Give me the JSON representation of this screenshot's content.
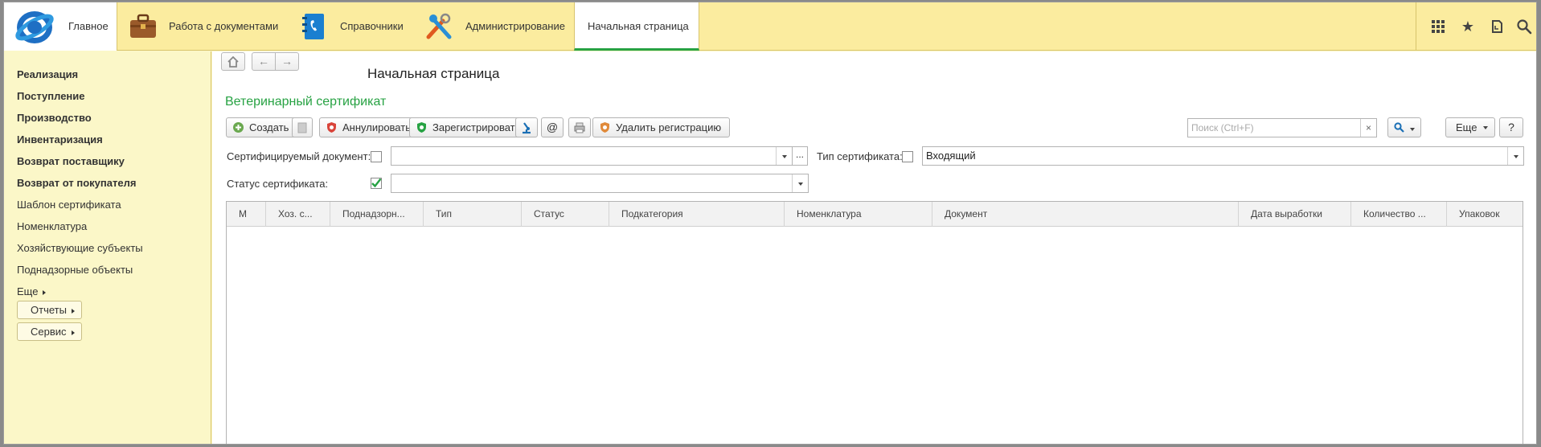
{
  "topbar": {
    "main_label": "Главное",
    "sections": [
      {
        "label": "Работа с документами",
        "icon": "briefcase-icon"
      },
      {
        "label": "Справочники",
        "icon": "phonebook-icon"
      },
      {
        "label": "Администрирование",
        "icon": "tools-icon"
      }
    ],
    "active_tab": "Начальная страница",
    "right_icons": [
      "apps-grid-icon",
      "star-icon",
      "history-icon",
      "search-icon"
    ]
  },
  "sidebar": {
    "items": [
      {
        "label": "Реализация",
        "bold": true
      },
      {
        "label": "Поступление",
        "bold": true
      },
      {
        "label": "Производство",
        "bold": true
      },
      {
        "label": "Инвентаризация",
        "bold": true
      },
      {
        "label": "Возврат поставщику",
        "bold": true
      },
      {
        "label": "Возврат от покупателя",
        "bold": true
      },
      {
        "label": "Шаблон сертификата",
        "bold": false
      },
      {
        "label": "Номенклатура",
        "bold": false
      },
      {
        "label": "Хозяйствующие субъекты",
        "bold": false
      },
      {
        "label": "Поднадзорные объекты",
        "bold": false
      }
    ],
    "more_label": "Еще",
    "reports_label": "Отчеты",
    "service_label": "Сервис"
  },
  "main": {
    "page_title": "Начальная страница",
    "form_title": "Ветеринарный сертификат",
    "toolbar": {
      "create_label": "Создать",
      "cancel_label": "Аннулировать",
      "register_label": "Зарегистрировать",
      "at_label": "@",
      "delete_registration_label": "Удалить регистрацию",
      "search_placeholder": "Поиск (Ctrl+F)",
      "search_clear": "×",
      "more_label": "Еще",
      "help_label": "?"
    },
    "filters": {
      "cert_doc_label": "Сертифицируемый документ:",
      "cert_doc_value": "",
      "cert_doc_more": "...",
      "cert_type_label": "Тип сертификата:",
      "cert_type_value": "Входящий",
      "cert_status_label": "Статус сертификата:",
      "cert_status_value": "",
      "cert_status_checked": true
    },
    "table": {
      "columns": [
        "М",
        "Хоз. с...",
        "Поднадзорн...",
        "Тип",
        "Статус",
        "Подкатегория",
        "Номенклатура",
        "Документ",
        "Дата выработки",
        "Количество ...",
        "Упаковок"
      ],
      "rows": []
    }
  },
  "colors": {
    "topbar_bg": "#fbec9f",
    "sidebar_bg": "#fbf7c8",
    "accent_green": "#27a243"
  }
}
